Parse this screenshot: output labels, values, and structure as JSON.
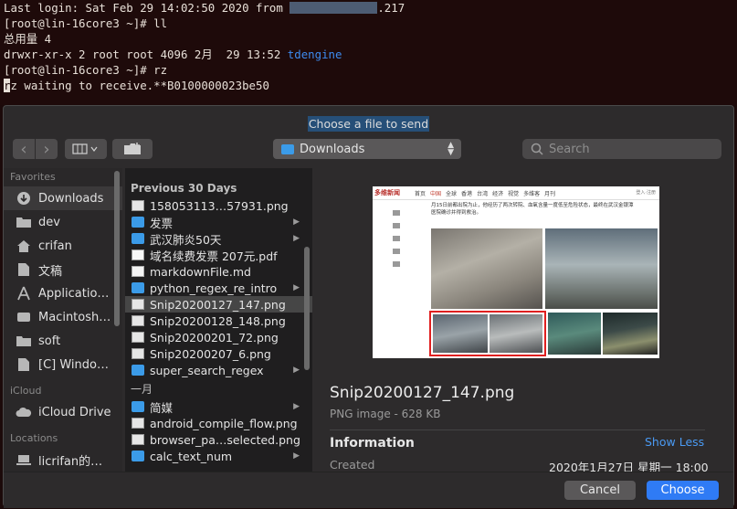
{
  "terminal": {
    "line1_prefix": "Last login: Sat Feb 29 14:02:50 2020 from ",
    "line1_suffix": ".217",
    "line2": "[root@lin-16core3 ~]# ll",
    "line3": "总用量 4",
    "line4_prefix": "drwxr-xr-x 2 root root 4096 2月  29 13:52 ",
    "line4_dir": "tdengine",
    "line5": "[root@lin-16core3 ~]# rz",
    "line6_cursor": "r",
    "line6_rest": "z waiting to receive.**B0100000023be50"
  },
  "dialog": {
    "title": "Choose a file to send",
    "location": "Downloads",
    "search_placeholder": "Search",
    "back_icon": "‹",
    "forward_icon": "›",
    "view_icon": "▥▾",
    "newfolder_icon": "📁"
  },
  "sidebar": {
    "favorites_head": "Favorites",
    "favorites": [
      {
        "label": "Downloads",
        "icon": "↓"
      },
      {
        "label": "dev",
        "icon": "▬"
      },
      {
        "label": "crifan",
        "icon": "⌂"
      },
      {
        "label": "文稿",
        "icon": "▤"
      },
      {
        "label": "Applicatio…",
        "icon": "A"
      },
      {
        "label": "Macintosh…",
        "icon": "◼"
      },
      {
        "label": "soft",
        "icon": "▬"
      },
      {
        "label": "[C] Windo…",
        "icon": "▤"
      }
    ],
    "icloud_head": "iCloud",
    "icloud": [
      {
        "label": "iCloud Drive",
        "icon": "☁"
      }
    ],
    "locations_head": "Locations",
    "locations": [
      {
        "label": "licrifan的…",
        "icon": "▭"
      }
    ]
  },
  "filelist": {
    "section1": "Previous 30 Days",
    "items1": [
      {
        "name": "158053113…57931.png",
        "type": "img",
        "folder": false
      },
      {
        "name": "发票",
        "type": "folder",
        "folder": true
      },
      {
        "name": "武汉肺炎50天",
        "type": "folder",
        "folder": true
      },
      {
        "name": "域名续费发票 207元.pdf",
        "type": "pdf",
        "folder": false
      },
      {
        "name": "markdownFile.md",
        "type": "file",
        "folder": false
      },
      {
        "name": "python_regex_re_intro",
        "type": "folder",
        "folder": true
      },
      {
        "name": "Snip20200127_147.png",
        "type": "img",
        "folder": false
      },
      {
        "name": "Snip20200128_148.png",
        "type": "img",
        "folder": false
      },
      {
        "name": "Snip20200201_72.png",
        "type": "img",
        "folder": false
      },
      {
        "name": "Snip20200207_6.png",
        "type": "img",
        "folder": false
      },
      {
        "name": "super_search_regex",
        "type": "folder",
        "folder": true
      }
    ],
    "section2": "一月",
    "items2": [
      {
        "name": "简媒",
        "type": "folder",
        "folder": true
      },
      {
        "name": "android_compile_flow.png",
        "type": "img",
        "folder": false
      },
      {
        "name": "browser_pa…selected.png",
        "type": "img",
        "folder": false
      },
      {
        "name": "calc_text_num",
        "type": "folder",
        "folder": true
      }
    ],
    "arrow": "▶"
  },
  "preview": {
    "filename": "Snip20200127_147.png",
    "filetype": "PNG image - 628 KB",
    "info_label": "Information",
    "show_less": "Show Less",
    "created_label": "Created",
    "created_value": "2020年1月27日 星期一 18:00",
    "thumb_logo": "多维新闻",
    "thumb_nav": [
      "首页",
      "中国",
      "全球",
      "香港",
      "台湾",
      "经济",
      "视觉",
      "多维客",
      "月刊"
    ],
    "thumb_login": "登入·注册",
    "thumb_text1": "月15日前都出院为止，他经历了两次转院、血氧含量一度低至危险状态，最终在武汉金银潭",
    "thumb_text2": "医院确诊并得到救治。"
  },
  "buttons": {
    "cancel": "Cancel",
    "choose": "Choose"
  },
  "colors": {
    "accent": "#2f7bf5",
    "folder": "#3b9be8",
    "terminal_bg": "#1e0a0a",
    "dialog_bg": "#2d2b2c"
  }
}
